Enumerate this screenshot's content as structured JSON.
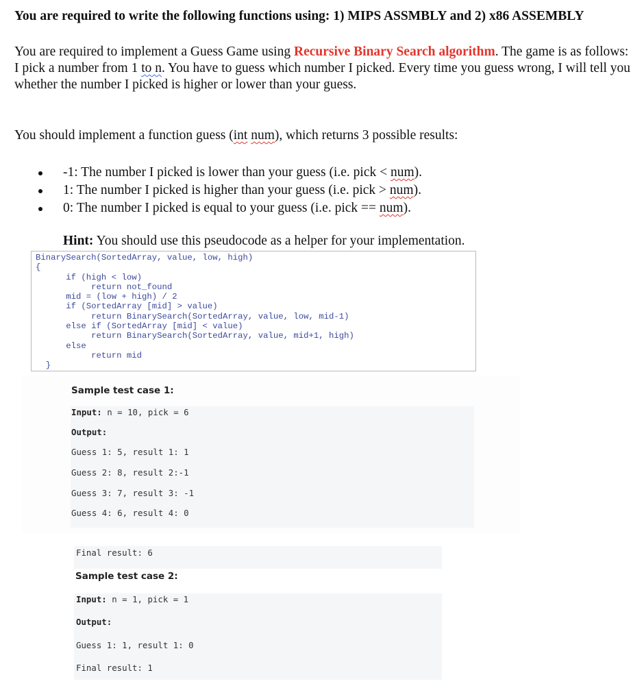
{
  "title": "You are required to write the following functions using: 1) MIPS ASSMBLY and 2) x86 ASSEMBLY",
  "intro": {
    "part1": "You are required to implement a Guess Game using ",
    "highlight": "Recursive Binary Search algorithm",
    "part2": ". The game is as follows:",
    "line2_pre": "I pick a number from 1 ",
    "line2_flag": "to n",
    "line2_post": ". You have to guess which number I picked. Every time you guess wrong, I will tell you whether the number I picked is higher or lower than your guess.",
    "highlight_color": "#e2362c"
  },
  "function_desc": {
    "pre": "You should implement a function guess (",
    "flag1": "int",
    "space": " ",
    "flag2": "num",
    "post": "), which returns 3 possible results:"
  },
  "results": [
    {
      "pre": "-1: The number I picked is lower than your guess (i.e. pick < ",
      "flag": "num",
      "post": ")."
    },
    {
      "pre": "1: The number I picked is higher than your guess (i.e. pick > ",
      "flag": "num",
      "post": ")."
    },
    {
      "pre": "0: The number I picked is equal to your guess (i.e. pick == ",
      "flag": "num",
      "post": ")."
    }
  ],
  "hint": {
    "label": "Hint:",
    "text": " You should use this pseudocode as a helper for your implementation."
  },
  "pseudocode": [
    "BinarySearch(SortedArray, value, low, high)",
    "{",
    "      if (high < low)",
    "           return not_found",
    "      mid = (low + high) / 2",
    "      if (SortedArray [mid] > value)",
    "           return BinarySearch(SortedArray, value, low, mid-1)",
    "      else if (SortedArray [mid] < value)",
    "           return BinarySearch(SortedArray, value, mid+1, high)",
    "      else",
    "           return mid",
    "  }"
  ],
  "sample1": {
    "heading": "Sample test case 1:",
    "input_label": "Input:",
    "input_value": " n = 10, pick = 6",
    "output_label": "Output:",
    "guesses": [
      "Guess 1: 5, result 1: 1",
      "Guess 2: 8, result 2:-1",
      "Guess 3: 7, result 3: -1",
      "Guess 4: 6, result 4: 0"
    ],
    "final": "Final result: 6"
  },
  "sample2": {
    "heading": "Sample test case 2:",
    "input_label": "Input:",
    "input_value": " n = 1, pick = 1",
    "output_label": "Output:",
    "guesses": [
      "Guess 1: 1, result 1: 0"
    ],
    "final": "Final result: 1"
  }
}
